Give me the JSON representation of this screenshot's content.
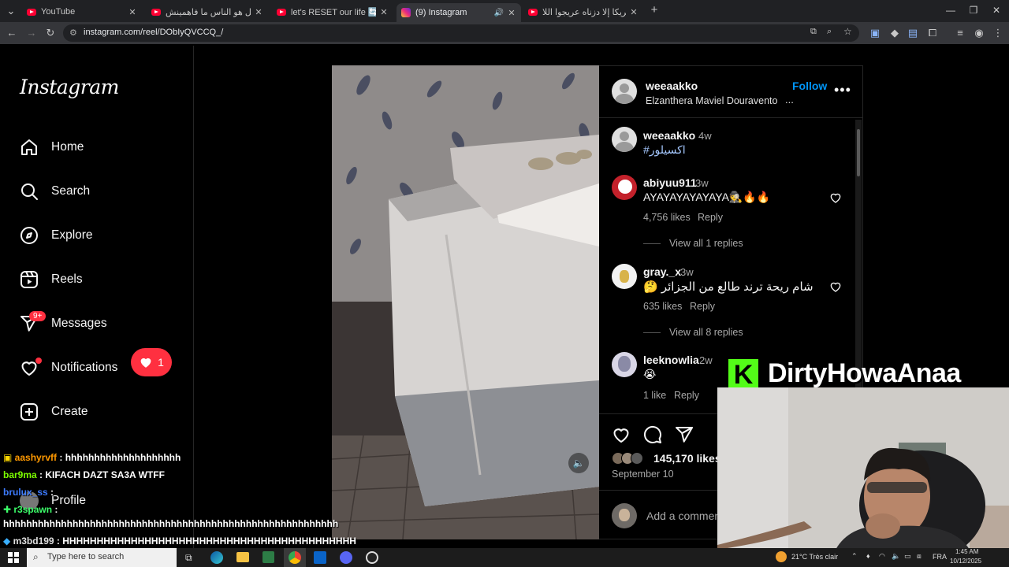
{
  "browser": {
    "tabs": [
      {
        "title": "YouTube",
        "icon": "youtube-icon"
      },
      {
        "title": "المشكل هو الناس ما فاهمينش 😂",
        "icon": "youtube-icon"
      },
      {
        "title": "let's RESET our life 🔄 البرنامج",
        "icon": "youtube-icon"
      },
      {
        "title": "(9) Instagram",
        "icon": "instagram-icon",
        "active": true
      },
      {
        "title": "منتخب أمريكا إلا دزناه عريجوا اللا...",
        "icon": "youtube-icon"
      }
    ],
    "new_tab": "+",
    "url": "instagram.com/reel/DObIyQVCCQ_/"
  },
  "sidebar": {
    "logo": "Instagram",
    "items": [
      {
        "label": "Home"
      },
      {
        "label": "Search"
      },
      {
        "label": "Explore"
      },
      {
        "label": "Reels"
      },
      {
        "label": "Messages",
        "badge": "9+"
      },
      {
        "label": "Notifications",
        "popup_count": "1"
      },
      {
        "label": "Create"
      },
      {
        "label": "Profile"
      }
    ]
  },
  "post": {
    "author": "weeaakko",
    "follow": "Follow",
    "audio": "Elzanthera Maviel Douravento •",
    "more": "...",
    "caption": {
      "user": "weeaakko",
      "time": "4w",
      "text": "#اكسيلور"
    },
    "comments": [
      {
        "user": "abiyuu911",
        "time": "3w",
        "text": "AYAYAYAYAYAYA🕵️🔥🔥",
        "likes": "4,756 likes",
        "reply": "Reply",
        "view_replies": "View all 1 replies"
      },
      {
        "user": "gray._x",
        "time": "3w",
        "text": "شام ريحة ترند طالع من الجزائر 🤔",
        "likes": "635 likes",
        "reply": "Reply",
        "view_replies": "View all 8 replies"
      },
      {
        "user": "leeknowlia",
        "time": "2w",
        "text": "😭",
        "likes": "1 like",
        "reply": "Reply"
      }
    ],
    "like_count": "145,170 likes",
    "date": "September 10",
    "add_comment_placeholder": "Add a comment..."
  },
  "stream_overlay": {
    "banner_text": "DirtyHowaAnaa",
    "banner_logo": "K",
    "chat": [
      {
        "user": "aashyrvff",
        "text": "hhhhhhhhhhhhhhhhhhhh",
        "user_color": "#ff9900"
      },
      {
        "user": "bar9ma",
        "text": "KIFACH DAZT SA3A WTFF",
        "user_color": "#7cfc00"
      },
      {
        "user": "brulux_ss",
        "text": "",
        "user_color": "#3d7bff"
      },
      {
        "user": "r3spawn",
        "text": "",
        "user_color": "#3cff6a"
      },
      {
        "user": "",
        "text": "hhhhhhhhhhhhhhhhhhhhhhhhhhhhhhhhhhhhhhhhhhhhhhhhhhhhhhhhhh",
        "user_color": "#ffffff"
      },
      {
        "user": "m3bd199",
        "text": "HHHHHHHHHHHHHHHHHHHHHHHHHHHHHHHHHHHHHHHHHHH",
        "user_color": "#e0e0e0"
      }
    ]
  },
  "taskbar": {
    "search_placeholder": "Type here to search",
    "weather": "21°C  Très clair",
    "lang": "FRA",
    "time": "1:45 AM",
    "date": "10/12/2025"
  }
}
